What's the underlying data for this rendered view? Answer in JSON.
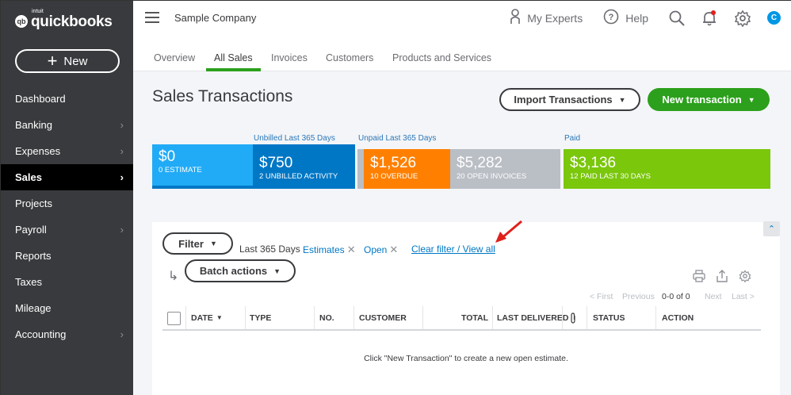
{
  "brand": {
    "intuit": "intuit",
    "name": "quickbooks",
    "mark": "qb"
  },
  "sidebar": {
    "new_label": "New",
    "items": [
      {
        "label": "Dashboard",
        "chevron": false,
        "active": false
      },
      {
        "label": "Banking",
        "chevron": true,
        "active": false
      },
      {
        "label": "Expenses",
        "chevron": true,
        "active": false
      },
      {
        "label": "Sales",
        "chevron": true,
        "active": true
      },
      {
        "label": "Projects",
        "chevron": false,
        "active": false
      },
      {
        "label": "Payroll",
        "chevron": true,
        "active": false
      },
      {
        "label": "Reports",
        "chevron": false,
        "active": false
      },
      {
        "label": "Taxes",
        "chevron": false,
        "active": false
      },
      {
        "label": "Mileage",
        "chevron": false,
        "active": false
      },
      {
        "label": "Accounting",
        "chevron": true,
        "active": false
      }
    ]
  },
  "topbar": {
    "company": "Sample Company",
    "my_experts": "My Experts",
    "help": "Help",
    "avatar_initial": "C"
  },
  "tabs": [
    "Overview",
    "All Sales",
    "Invoices",
    "Customers",
    "Products and Services"
  ],
  "active_tab": "All Sales",
  "page": {
    "title": "Sales Transactions",
    "import_label": "Import Transactions",
    "new_transaction_label": "New transaction"
  },
  "money_bar": {
    "unbilled_label": "Unbilled Last 365 Days",
    "unpaid_label": "Unpaid Last 365 Days",
    "paid_label": "Paid",
    "estimate": {
      "amount": "$0",
      "label": "0 ESTIMATE"
    },
    "unbilled": {
      "amount": "$750",
      "label": "2 UNBILLED ACTIVITY"
    },
    "overdue": {
      "amount": "$1,526",
      "label": "10 OVERDUE"
    },
    "open": {
      "amount": "$5,282",
      "label": "20 OPEN INVOICES"
    },
    "paid": {
      "amount": "$3,136",
      "label": "12 PAID LAST 30 DAYS"
    }
  },
  "filters": {
    "filter_label": "Filter",
    "period": "Last 365 Days",
    "type": "Estimates",
    "status": "Open",
    "clear_label": "Clear filter / View all",
    "batch_label": "Batch actions"
  },
  "pager": {
    "first": "< First",
    "previous": "Previous",
    "count": "0-0 of 0",
    "next": "Next",
    "last": "Last >"
  },
  "table": {
    "columns": [
      "DATE",
      "TYPE",
      "NO.",
      "CUSTOMER",
      "TOTAL",
      "LAST DELIVERED",
      "STATUS",
      "ACTION"
    ],
    "empty_message": "Click \"New Transaction\" to create a new open estimate."
  },
  "colors": {
    "sidebar": "#393a3d",
    "accent_green": "#2ca01c",
    "estimate": "#21abf6",
    "unbilled": "#0077c5",
    "overdue": "#ff8000",
    "open": "#babec5",
    "paid": "#7ac70c",
    "annotation_arrow": "#e0201b"
  },
  "icons": [
    "hamburger-icon",
    "expert-icon",
    "help-icon",
    "search-icon",
    "notification-bell-icon",
    "gear-icon",
    "print-icon",
    "export-icon",
    "settings-icon",
    "attachment-icon",
    "sort-arrow-icon",
    "collapse-up-icon"
  ]
}
